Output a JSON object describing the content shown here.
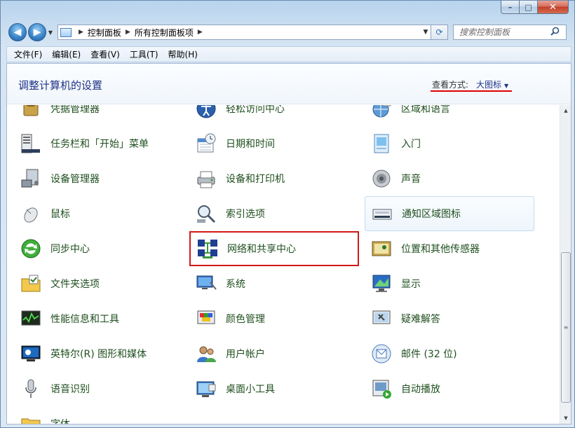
{
  "window": {
    "caption": {
      "minimize": "–",
      "maximize": "□",
      "close": "✕"
    }
  },
  "navigation": {
    "breadcrumb": [
      "控制面板",
      "所有控制面板项"
    ],
    "search_placeholder": "搜索控制面板"
  },
  "menu": [
    "文件(F)",
    "编辑(E)",
    "查看(V)",
    "工具(T)",
    "帮助(H)"
  ],
  "header": {
    "title": "调整计算机的设置",
    "view_by_label": "查看方式:",
    "view_mode": "大图标"
  },
  "items": [
    [
      {
        "label": "凭据管理器",
        "icon": "credential-manager-icon"
      },
      {
        "label": "轻松访问中心",
        "icon": "ease-of-access-icon"
      },
      {
        "label": "区域和语言",
        "icon": "region-language-icon"
      }
    ],
    [
      {
        "label": "任务栏和「开始」菜单",
        "icon": "taskbar-start-menu-icon"
      },
      {
        "label": "日期和时间",
        "icon": "date-time-icon"
      },
      {
        "label": "入门",
        "icon": "getting-started-icon"
      }
    ],
    [
      {
        "label": "设备管理器",
        "icon": "device-manager-icon"
      },
      {
        "label": "设备和打印机",
        "icon": "devices-printers-icon"
      },
      {
        "label": "声音",
        "icon": "sound-icon"
      }
    ],
    [
      {
        "label": "鼠标",
        "icon": "mouse-icon"
      },
      {
        "label": "索引选项",
        "icon": "indexing-options-icon"
      },
      {
        "label": "通知区域图标",
        "icon": "notification-area-icon"
      }
    ],
    [
      {
        "label": "同步中心",
        "icon": "sync-center-icon"
      },
      {
        "label": "网络和共享中心",
        "icon": "network-sharing-icon"
      },
      {
        "label": "位置和其他传感器",
        "icon": "location-sensors-icon"
      }
    ],
    [
      {
        "label": "文件夹选项",
        "icon": "folder-options-icon"
      },
      {
        "label": "系统",
        "icon": "system-icon"
      },
      {
        "label": "显示",
        "icon": "display-icon"
      }
    ],
    [
      {
        "label": "性能信息和工具",
        "icon": "performance-icon"
      },
      {
        "label": "颜色管理",
        "icon": "color-management-icon"
      },
      {
        "label": "疑难解答",
        "icon": "troubleshooting-icon"
      }
    ],
    [
      {
        "label": "英特尔(R) 图形和媒体",
        "icon": "intel-graphics-icon"
      },
      {
        "label": "用户帐户",
        "icon": "user-accounts-icon"
      },
      {
        "label": "邮件 (32 位)",
        "icon": "mail-icon"
      }
    ],
    [
      {
        "label": "语音识别",
        "icon": "speech-recognition-icon"
      },
      {
        "label": "桌面小工具",
        "icon": "desktop-gadgets-icon"
      },
      {
        "label": "自动播放",
        "icon": "autoplay-icon"
      }
    ],
    [
      {
        "label": "字体",
        "icon": "fonts-icon"
      }
    ]
  ],
  "colors": {
    "item_text": "#1f4f1f",
    "header_title": "#1e3287",
    "highlight_box": "#d21818"
  }
}
